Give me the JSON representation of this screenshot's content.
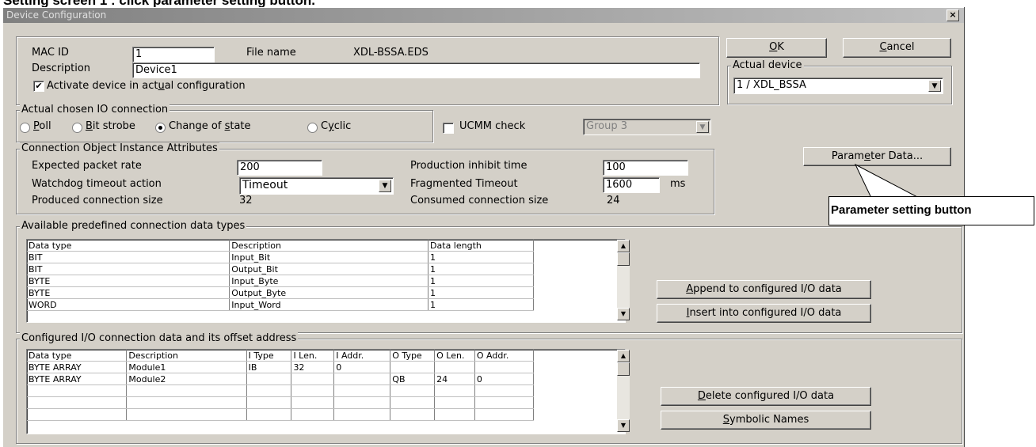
{
  "caption": "Setting screen 1 : click parameter setting button.",
  "window": {
    "title": "Device Configuration",
    "close": "×"
  },
  "device": {
    "mac_label": "MAC ID",
    "mac_value": "1",
    "file_label": "File name",
    "file_value": "XDL-BSSA.EDS",
    "desc_label": "Description",
    "desc_value": "Device1",
    "activate_pre": "Activate device in act",
    "activate_ul": "u",
    "activate_post": "al configuration",
    "activate_checked": true
  },
  "buttons": {
    "ok": "O",
    "ok_rest": "K",
    "cancel": "C",
    "cancel_rest": "ancel",
    "param_pre": "Param",
    "param_ul": "e",
    "param_post": "ter Data...",
    "append_ul": "A",
    "append_rest": "ppend to configured I/O data",
    "insert_ul": "I",
    "insert_rest": "nsert into configured I/O data",
    "delete_ul": "D",
    "delete_rest": "elete configured I/O data",
    "symbolic_ul": "S",
    "symbolic_rest": "ymbolic Names"
  },
  "actual_device": {
    "title": "Actual device",
    "value": "1 / XDL_BSSA"
  },
  "io_connection": {
    "title": "Actual chosen IO connection",
    "options": [
      {
        "ul": "P",
        "rest": "oll",
        "selected": false
      },
      {
        "ul": "B",
        "rest": "it strobe",
        "selected": false
      },
      {
        "pre": "Change of ",
        "ul": "s",
        "rest": "tate",
        "selected": true
      },
      {
        "pre": "C",
        "ul": "y",
        "rest": "clic",
        "selected": false
      }
    ],
    "ucmm_label": "UCMM check",
    "ucmm_checked": false,
    "group_value": "Group 3"
  },
  "attributes": {
    "title": "Connection Object Instance Attributes",
    "expected_label": "Expected packet rate",
    "expected_value": "200",
    "watchdog_label": "Watchdog timeout action",
    "watchdog_value": "Timeout",
    "produced_label": "Produced connection size",
    "produced_value": "32",
    "inhibit_label": "Production inhibit time",
    "inhibit_value": "100",
    "fragmented_label": "Fragmented Timeout",
    "fragmented_value": "1600",
    "fragmented_unit": "ms",
    "consumed_label": "Consumed connection size",
    "consumed_value": "24"
  },
  "available": {
    "title": "Available predefined connection data types",
    "headers": [
      "Data type",
      "Description",
      "Data length"
    ],
    "rows": [
      [
        "BIT",
        "Input_Bit",
        "1"
      ],
      [
        "BIT",
        "Output_Bit",
        "1"
      ],
      [
        "BYTE",
        "Input_Byte",
        "1"
      ],
      [
        "BYTE",
        "Output_Byte",
        "1"
      ],
      [
        "WORD",
        "Input_Word",
        "1"
      ]
    ]
  },
  "configured": {
    "title": "Configured I/O connection data and its offset address",
    "headers": [
      "Data type",
      "Description",
      "I Type",
      "I Len.",
      "I Addr.",
      "O Type",
      "O Len.",
      "O Addr."
    ],
    "rows": [
      [
        "BYTE ARRAY",
        "Module1",
        "IB",
        "32",
        "0",
        "",
        "",
        ""
      ],
      [
        "BYTE ARRAY",
        "Module2",
        "",
        "",
        "",
        "QB",
        "24",
        "0"
      ],
      [
        "",
        "",
        "",
        "",
        "",
        "",
        "",
        ""
      ],
      [
        "",
        "",
        "",
        "",
        "",
        "",
        "",
        ""
      ],
      [
        "",
        "",
        "",
        "",
        "",
        "",
        "",
        ""
      ]
    ]
  },
  "callout": "Parameter setting button"
}
